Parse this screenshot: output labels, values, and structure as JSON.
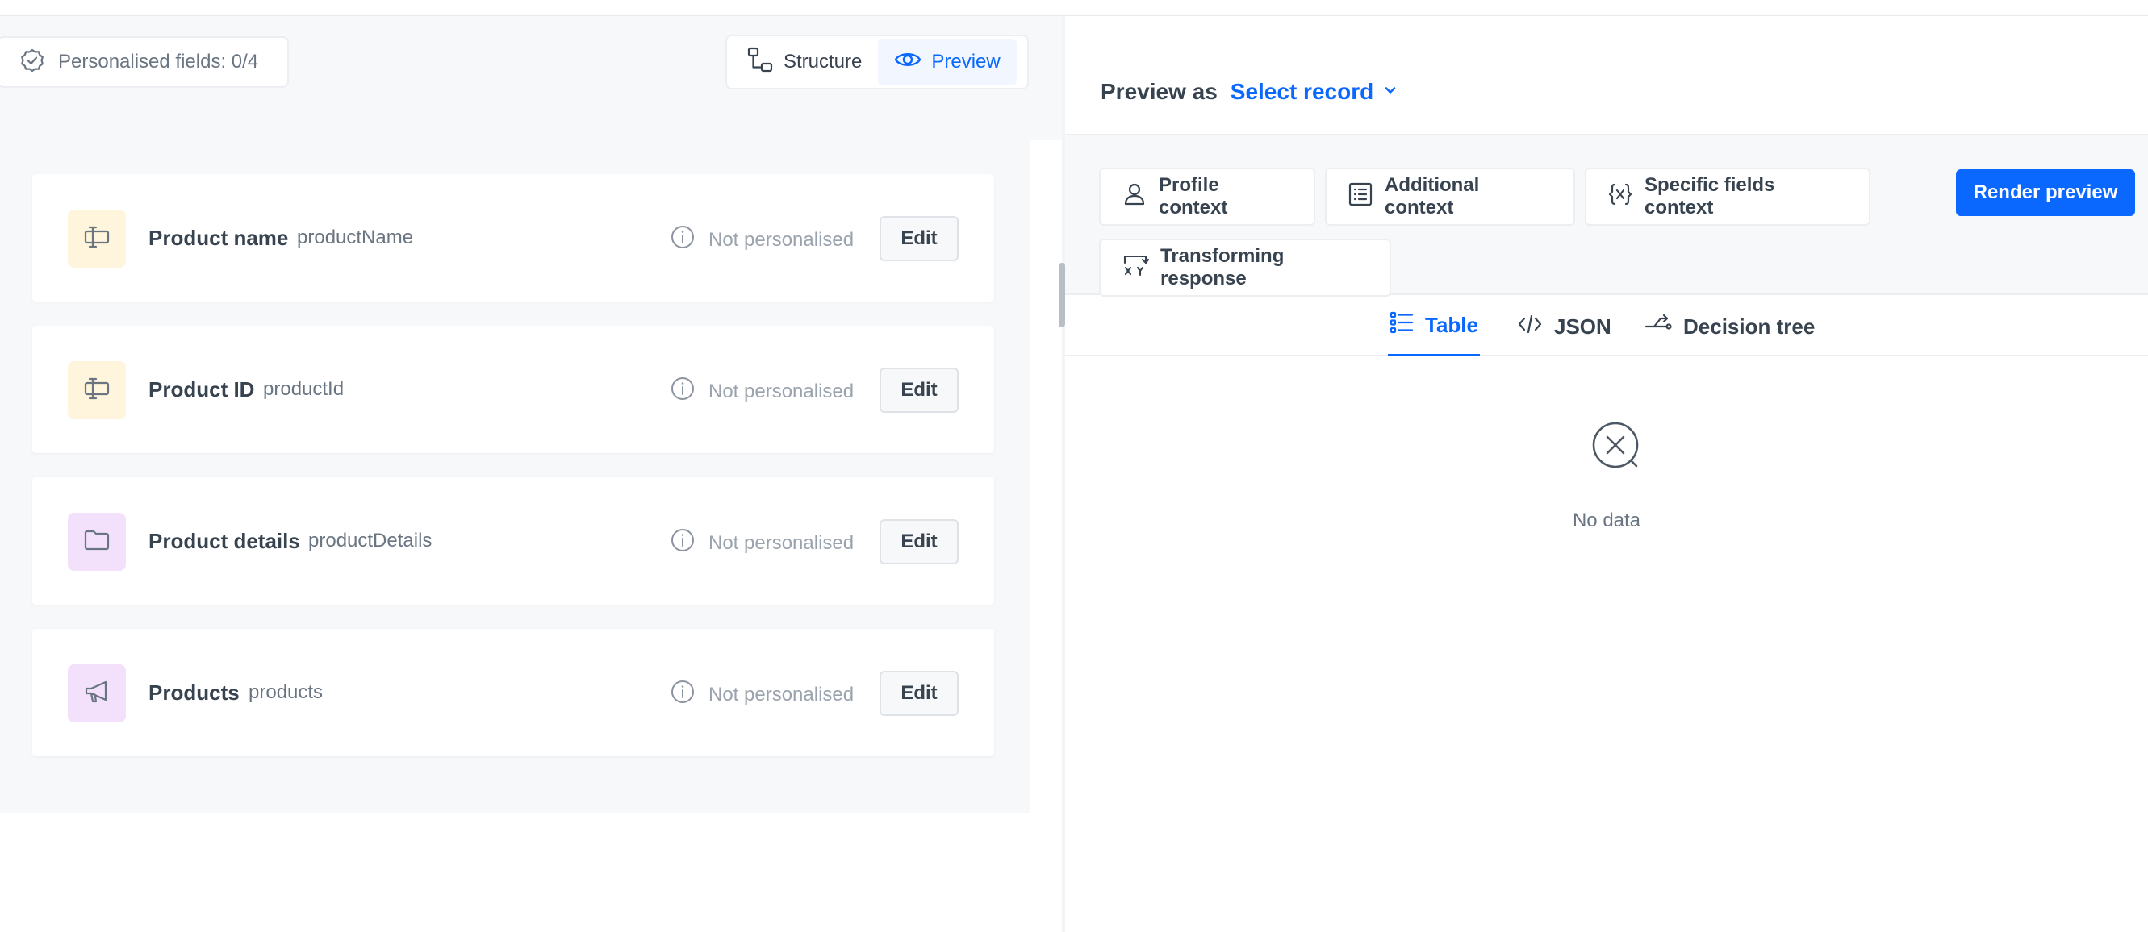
{
  "left": {
    "personalised_fields": "Personalised fields: 0/4",
    "view_toggle": {
      "structure": "Structure",
      "preview": "Preview"
    },
    "fields": [
      {
        "name": "Product name",
        "key": "productName",
        "status": "Not personalised",
        "edit": "Edit",
        "icon": "text-field-icon",
        "color": "#fff4dc"
      },
      {
        "name": "Product ID",
        "key": "productId",
        "status": "Not personalised",
        "edit": "Edit",
        "icon": "text-field-icon",
        "color": "#fff4dc"
      },
      {
        "name": "Product details",
        "key": "productDetails",
        "status": "Not personalised",
        "edit": "Edit",
        "icon": "folder-icon",
        "color": "#f3e0fb"
      },
      {
        "name": "Products",
        "key": "products",
        "status": "Not personalised",
        "edit": "Edit",
        "icon": "megaphone-icon",
        "color": "#f3e0fb"
      }
    ]
  },
  "right": {
    "preview_as_label": "Preview as",
    "select_record": "Select record",
    "contexts": [
      {
        "label": "Profile context",
        "icon": "user-icon"
      },
      {
        "label": "Additional context",
        "icon": "list-icon"
      },
      {
        "label": "Specific fields context",
        "icon": "variable-icon"
      },
      {
        "label": "Transforming response",
        "icon": "transform-icon"
      }
    ],
    "render_button": "Render preview",
    "tabs": {
      "table": "Table",
      "json": "JSON",
      "decision_tree": "Decision tree"
    },
    "empty_text": "No data"
  },
  "colors": {
    "accent": "#0b68ff",
    "text": "#384350",
    "muted": "#6a7582"
  }
}
